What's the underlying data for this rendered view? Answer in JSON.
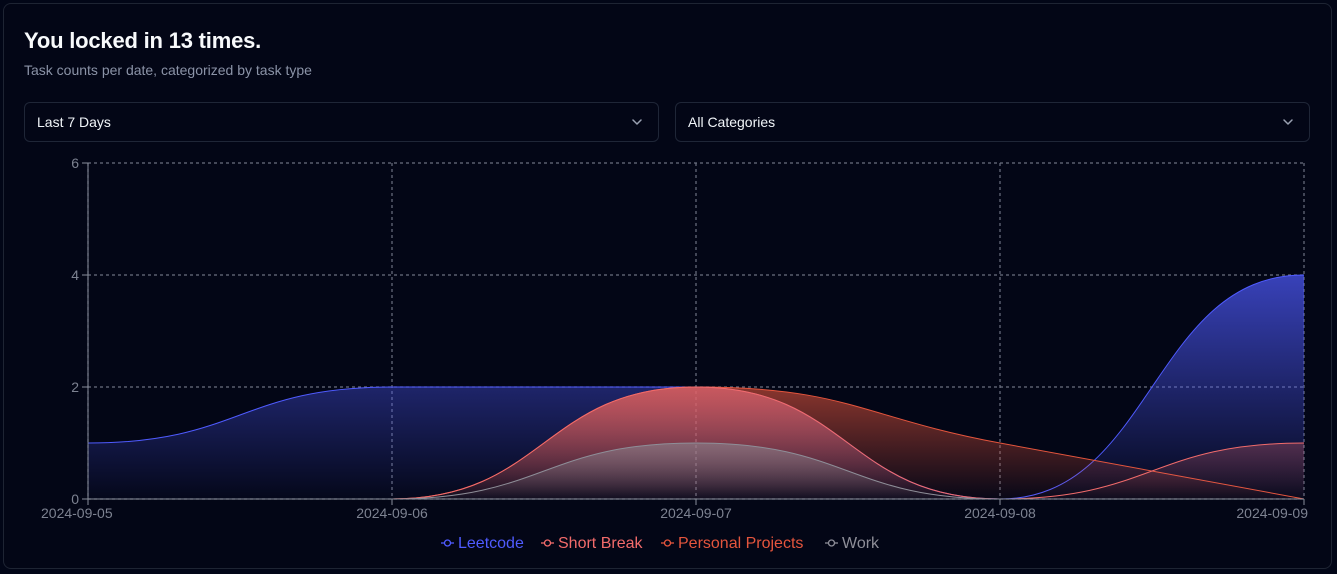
{
  "header": {
    "title": "You locked in 13 times.",
    "subtitle": "Task counts per date, categorized by task type"
  },
  "filters": {
    "range_selected": "Last 7 Days",
    "category_selected": "All Categories"
  },
  "chart_data": {
    "type": "area",
    "categories": [
      "2024-09-05",
      "2024-09-06",
      "2024-09-07",
      "2024-09-08",
      "2024-09-09"
    ],
    "y_ticks": [
      "0",
      "2",
      "4",
      "6"
    ],
    "ylim": [
      0,
      6
    ],
    "grid": true,
    "legend_position": "bottom",
    "series": [
      {
        "name": "Leetcode",
        "values": [
          1,
          2,
          2,
          0,
          4
        ],
        "color": "#4f5bff",
        "curve": "smooth"
      },
      {
        "name": "Short Break",
        "values": [
          0,
          0,
          2,
          0,
          1
        ],
        "color": "#f26b6b",
        "curve": "smooth"
      },
      {
        "name": "Personal Projects",
        "values": [
          0,
          0,
          2,
          1,
          0
        ],
        "color": "#e4553d",
        "curve": "linear-after-peak"
      },
      {
        "name": "Work",
        "values": [
          0,
          0,
          1,
          0,
          0
        ],
        "color": "#8e8e98",
        "curve": "smooth"
      }
    ]
  }
}
